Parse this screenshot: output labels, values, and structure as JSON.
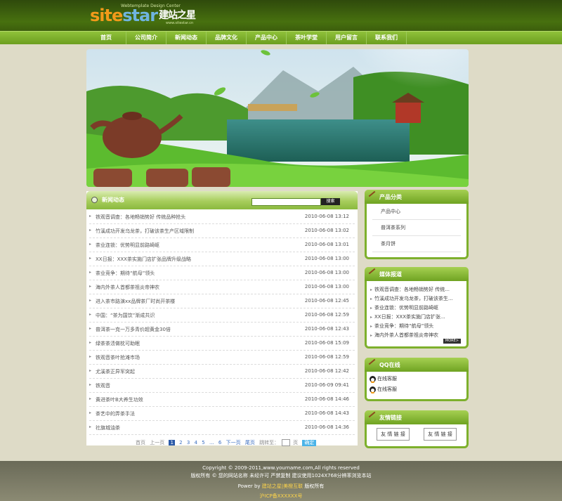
{
  "logo": {
    "main_a": "site",
    "main_b": "star",
    "cn": "建站之星",
    "sub": "Webtemplate Design Center",
    "url": "www.sitestar.cn"
  },
  "nav": [
    "首页",
    "公司简介",
    "新闻动态",
    "品牌文化",
    "产品中心",
    "茶叶学堂",
    "用户留言",
    "联系我们"
  ],
  "news": {
    "title": "新闻动态",
    "search_btn": "搜索",
    "items": [
      {
        "title": "铁观音调查：各地畅销势好 传统品种抢头",
        "date": "2010-06-08 13:12"
      },
      {
        "title": "竹溪成功开发乌龙茶，打破该茶生产区域限制",
        "date": "2010-06-08 13:02"
      },
      {
        "title": "茶业连锁：优势明显前路崎岖",
        "date": "2010-06-08 13:01"
      },
      {
        "title": "XX日报：XXX茶实施门店扩张品牌升级战略",
        "date": "2010-06-08 13:00"
      },
      {
        "title": "茶业竞争：期待“航母”领头",
        "date": "2010-06-08 13:00"
      },
      {
        "title": "海内外茶人首都茶祖炎帝神农",
        "date": "2010-06-08 13:00"
      },
      {
        "title": "进入茶市路演xx品牌茶厂时尚开茶楼",
        "date": "2010-06-08 12:45"
      },
      {
        "title": "中国：“茶为国饮”渐成共识",
        "date": "2010-06-08 12:59"
      },
      {
        "title": "普洱茶一克一万多青价超黄金30倍",
        "date": "2010-06-08 12:43"
      },
      {
        "title": "绿茶茶渍做枕可助眠",
        "date": "2010-06-08 15:09"
      },
      {
        "title": "铁观音茶叶抢滩市场",
        "date": "2010-06-08 12:59"
      },
      {
        "title": "尤溪茶正异军突起",
        "date": "2010-06-08 12:42"
      },
      {
        "title": "铁观音",
        "date": "2010-06-09 09:41"
      },
      {
        "title": "黄进茶叶B大养生功效",
        "date": "2010-06-08 14:46"
      },
      {
        "title": "茶艺中的弄茶手法",
        "date": "2010-06-08 14:43"
      },
      {
        "title": "社旗城油茶",
        "date": "2010-06-08 14:36"
      }
    ]
  },
  "pager": {
    "first": "首页",
    "prev": "上一页",
    "pages": [
      "1",
      "2",
      "3",
      "4",
      "5",
      "6"
    ],
    "ellipsis": "...",
    "next": "下一页",
    "last": "尾页",
    "goto": "跳转至：",
    "unit": "页",
    "go": "确定"
  },
  "products": {
    "title": "产品分类",
    "items": [
      "产品中心",
      "普洱茶系列",
      "茶月饼"
    ]
  },
  "media": {
    "title": "媒体报道",
    "items": [
      "铁观音调查：各地畅销势好 传统...",
      "竹溪成功开发乌龙茶，打破该茶生...",
      "茶业连锁：优势明显前路崎岖",
      "XX日报：XXX茶实施门店扩张...",
      "茶业竞争：期待“航母”领头",
      "海内外茶人首都茶祖炎帝神农"
    ],
    "more": "MORE>"
  },
  "qq": {
    "title": "QQ在线",
    "items": [
      "在线客服",
      "在线客服"
    ]
  },
  "links": {
    "title": "友情链接",
    "items": [
      "友 情 链 接",
      "友 情 链 接"
    ]
  },
  "footer": {
    "copyright": "Copyright © 2009-2011,www.yourname.com,All rights reserved",
    "line2": "版权所有 © 您的网站名称  未经许可  严禁复制  建议使用1024X768分辨率浏览本站",
    "power_pre": "Power by ",
    "power_link": "建站之星",
    "power_mid": "|美橙互联",
    "power_post": " 版权所有",
    "icp": "沪ICP备XXXXXX号"
  }
}
